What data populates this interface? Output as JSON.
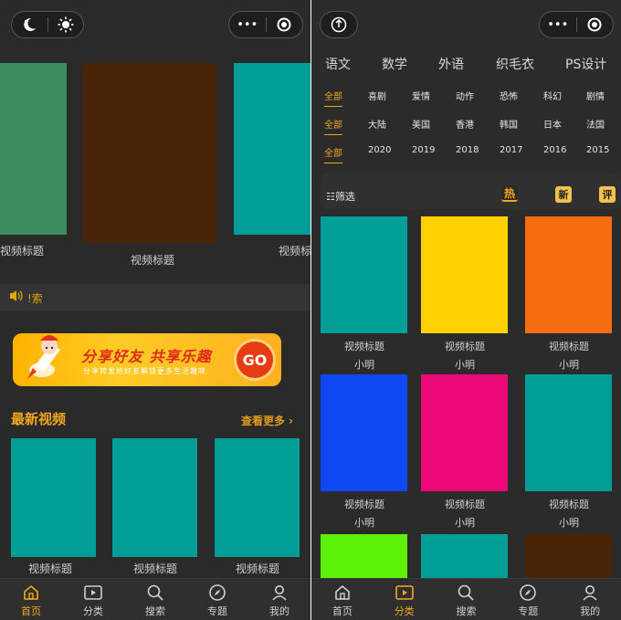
{
  "left_screen": {
    "capsule_left": {
      "moon_icon": "moon-icon",
      "sun_icon": "sun-icon"
    },
    "capsule_right": {
      "menu": "•••",
      "record": "record-icon"
    },
    "banner": [
      {
        "color": "#3c8d5f",
        "caption": "视频标题"
      },
      {
        "color": "#4a2407",
        "caption": "视频标题"
      },
      {
        "color": "#009e96",
        "caption": "视频标题"
      }
    ],
    "notice": {
      "icon": "speaker-icon",
      "text": "!索"
    },
    "share": {
      "title": "分享好友  共享乐趣",
      "subtitle": "分享转发给好友解锁更多生活趣味",
      "go_label": "GO"
    },
    "latest": {
      "title": "最新视频",
      "more_label": "查看更多 ›"
    },
    "latest_videos": [
      {
        "color": "#009e96",
        "caption": "视频标题"
      },
      {
        "color": "#009e96",
        "caption": "视频标题"
      },
      {
        "color": "#009e96",
        "caption": "视频标题"
      }
    ],
    "tabbar": [
      {
        "label": "首页",
        "icon": "home-icon",
        "active": true
      },
      {
        "label": "分类",
        "icon": "play-icon",
        "active": false
      },
      {
        "label": "搜索",
        "icon": "search-icon",
        "active": false
      },
      {
        "label": "专题",
        "icon": "compass-icon",
        "active": false
      },
      {
        "label": "我的",
        "icon": "user-icon",
        "active": false
      }
    ]
  },
  "right_screen": {
    "capsule_left": {
      "upload_icon": "upload-icon"
    },
    "capsule_right": {
      "menu": "•••",
      "record": "record-icon"
    },
    "subjects": [
      "语文",
      "数学",
      "外语",
      "织毛衣",
      "PS设计"
    ],
    "filters": {
      "genre": [
        "全部",
        "喜剧",
        "爱情",
        "动作",
        "恐怖",
        "科幻",
        "剧情"
      ],
      "region": [
        "全部",
        "大陆",
        "美国",
        "香港",
        "韩国",
        "日本",
        "法国"
      ],
      "year": [
        "全部",
        "2020",
        "2019",
        "2018",
        "2017",
        "2016",
        "2015"
      ]
    },
    "filter_bar": {
      "label": "☷筛选",
      "hot": "热",
      "new": "新",
      "rating": "评"
    },
    "videos": [
      {
        "color": "#009e96",
        "title": "视频标题",
        "author": "小明"
      },
      {
        "color": "#ffd200",
        "title": "视频标题",
        "author": "小明"
      },
      {
        "color": "#f46b10",
        "title": "视频标题",
        "author": "小明"
      },
      {
        "color": "#0d48f2",
        "title": "视频标题",
        "author": "小明"
      },
      {
        "color": "#ec0a78",
        "title": "视频标题",
        "author": "小明"
      },
      {
        "color": "#009e96",
        "title": "视频标题",
        "author": "小明"
      },
      {
        "color": "#5cf20a",
        "title": "",
        "author": ""
      },
      {
        "color": "#009e96",
        "title": "",
        "author": ""
      },
      {
        "color": "#4a2407",
        "title": "",
        "author": ""
      }
    ],
    "tabbar": [
      {
        "label": "首页",
        "icon": "home-icon",
        "active": false
      },
      {
        "label": "分类",
        "icon": "play-icon",
        "active": true
      },
      {
        "label": "搜索",
        "icon": "search-icon",
        "active": false
      },
      {
        "label": "专题",
        "icon": "compass-icon",
        "active": false
      },
      {
        "label": "我的",
        "icon": "user-icon",
        "active": false
      }
    ]
  }
}
